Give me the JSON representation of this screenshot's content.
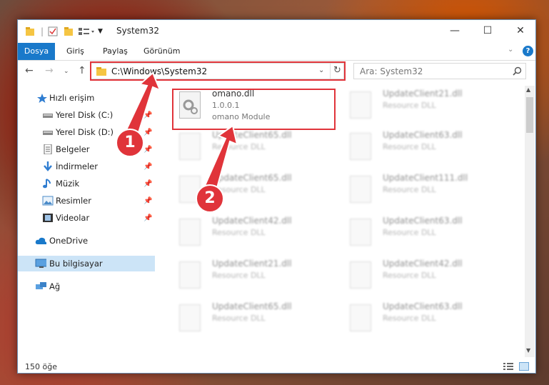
{
  "window": {
    "title": "System32",
    "ribbon_tabs": [
      "Dosya",
      "Giriş",
      "Paylaş",
      "Görünüm"
    ]
  },
  "navigation": {
    "address": "C:\\Windows\\System32",
    "search_placeholder": "Ara: System32"
  },
  "sidebar": {
    "quick_access": "Hızlı erişim",
    "items": [
      {
        "label": "Yerel Disk (C:)",
        "icon": "drive-icon",
        "pinned": true
      },
      {
        "label": "Yerel Disk (D:)",
        "icon": "drive-icon",
        "pinned": true
      },
      {
        "label": "Belgeler",
        "icon": "documents-icon",
        "pinned": true
      },
      {
        "label": "İndirmeler",
        "icon": "download-icon",
        "pinned": true
      },
      {
        "label": "Müzik",
        "icon": "music-icon",
        "pinned": true
      },
      {
        "label": "Resimler",
        "icon": "pictures-icon",
        "pinned": true
      },
      {
        "label": "Videolar",
        "icon": "video-icon",
        "pinned": true
      }
    ],
    "onedrive": "OneDrive",
    "this_pc": "Bu bilgisayar",
    "network": "Ağ"
  },
  "files": [
    {
      "name": "omano.dll",
      "sub1": "1.0.0.1",
      "sub2": "omano Module",
      "highlighted": true
    },
    {
      "name": "UpdateClient21.dll",
      "sub1": "Resource DLL"
    },
    {
      "name": "UpdateClient65.dll",
      "sub1": "Resource DLL"
    },
    {
      "name": "UpdateClient63.dll",
      "sub1": "Resource DLL"
    },
    {
      "name": "UpdateClient65.dll",
      "sub1": "Resource DLL"
    },
    {
      "name": "UpdateClient111.dll",
      "sub1": "Resource DLL"
    },
    {
      "name": "UpdateClient42.dll",
      "sub1": "Resource DLL"
    },
    {
      "name": "UpdateClient63.dll",
      "sub1": "Resource DLL"
    },
    {
      "name": "UpdateClient21.dll",
      "sub1": "Resource DLL"
    },
    {
      "name": "UpdateClient42.dll",
      "sub1": "Resource DLL"
    },
    {
      "name": "UpdateClient65.dll",
      "sub1": "Resource DLL"
    },
    {
      "name": "UpdateClient63.dll",
      "sub1": "Resource DLL"
    }
  ],
  "status": {
    "item_count": "150 öğe"
  },
  "markers": [
    "1",
    "2"
  ],
  "colors": {
    "accent": "#1979ca",
    "highlight": "#e0343a"
  }
}
